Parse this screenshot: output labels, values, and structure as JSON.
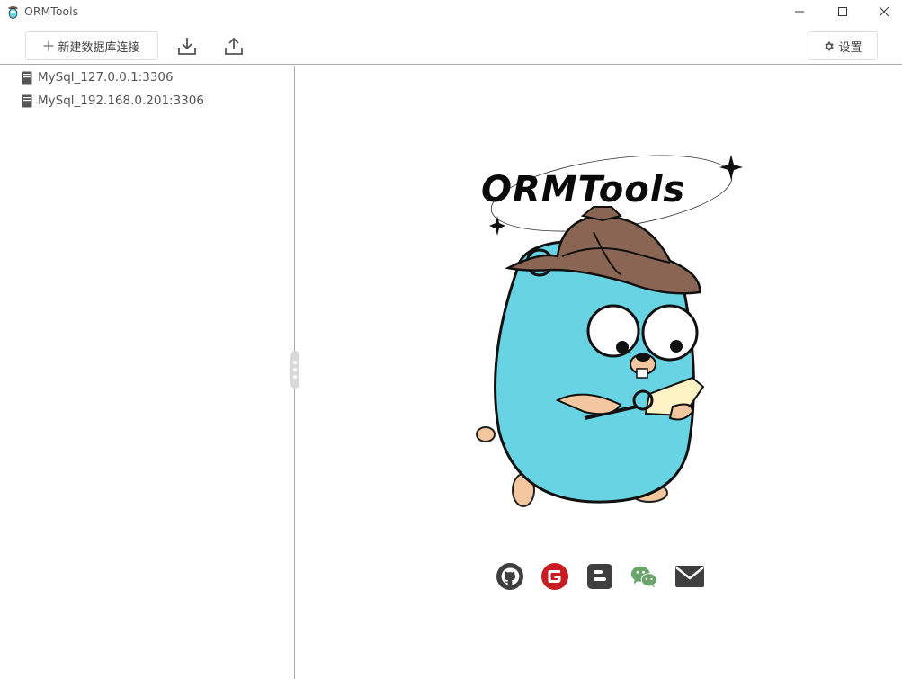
{
  "window": {
    "title": "ORMTools"
  },
  "toolbar": {
    "new_connection_label": "新建数据库连接",
    "settings_label": "设置"
  },
  "sidebar": {
    "items": [
      {
        "label": "MySql_127.0.0.1:3306"
      },
      {
        "label": "MySql_192.168.0.201:3306"
      }
    ]
  },
  "main": {
    "logo_text": "ORMTools",
    "social_icons": [
      "github-icon",
      "gitee-icon",
      "blogger-icon",
      "wechat-icon",
      "mail-icon"
    ]
  },
  "colors": {
    "gopher_body": "#68d4e3",
    "hat": "#8b6553",
    "gitee_red": "#c71d23",
    "wechat_green": "#6aa56b",
    "dark_icon": "#3f3f3f"
  }
}
